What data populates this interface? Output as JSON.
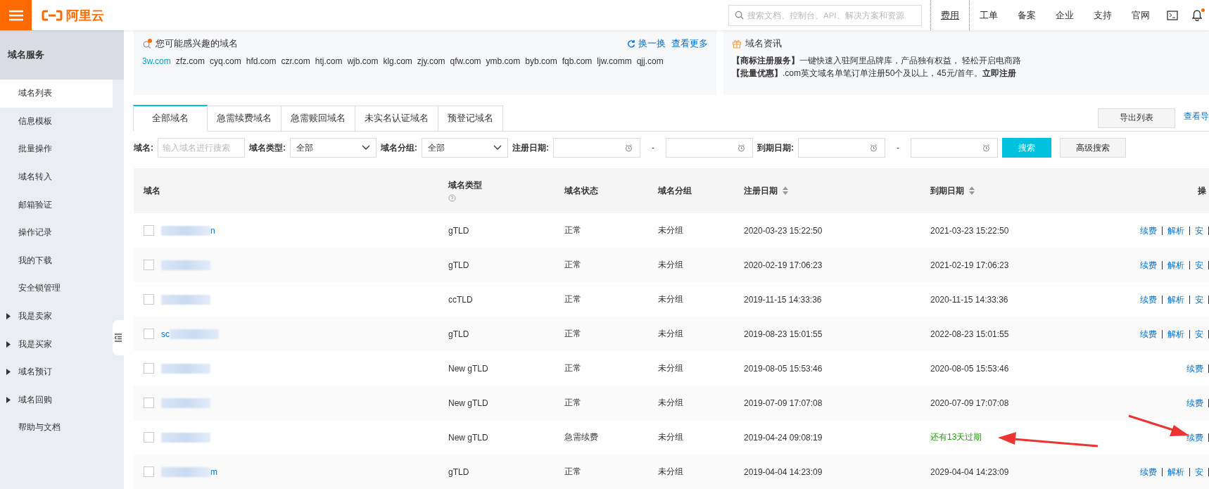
{
  "topbar": {
    "logo_text": "阿里云",
    "search": {
      "placeholder": "搜索文档、控制台、API、解决方案和资源"
    },
    "nav": [
      {
        "label": "费用",
        "selected": true
      },
      {
        "label": "工单",
        "selected": false
      },
      {
        "label": "备案",
        "selected": false
      },
      {
        "label": "企业",
        "selected": false
      },
      {
        "label": "支持",
        "selected": false
      },
      {
        "label": "官网",
        "selected": false
      }
    ],
    "notification_dot": true
  },
  "sidebar": {
    "title": "域名服务",
    "items": [
      {
        "label": "域名列表",
        "kind": "item",
        "selected": true
      },
      {
        "label": "信息模板",
        "kind": "item",
        "selected": false
      },
      {
        "label": "批量操作",
        "kind": "item",
        "selected": false
      },
      {
        "label": "域名转入",
        "kind": "item",
        "selected": false
      },
      {
        "label": "邮箱验证",
        "kind": "item",
        "selected": false
      },
      {
        "label": "操作记录",
        "kind": "item",
        "selected": false
      },
      {
        "label": "我的下载",
        "kind": "item",
        "selected": false
      },
      {
        "label": "安全锁管理",
        "kind": "item",
        "selected": false
      },
      {
        "label": "我是卖家",
        "kind": "group",
        "selected": false
      },
      {
        "label": "我是买家",
        "kind": "group",
        "selected": false
      },
      {
        "label": "域名预订",
        "kind": "group",
        "selected": false
      },
      {
        "label": "域名回购",
        "kind": "group",
        "selected": false
      },
      {
        "label": "帮助与文档",
        "kind": "item",
        "selected": false
      }
    ]
  },
  "suggestions": {
    "title": "您可能感兴趣的域名",
    "refresh": "换一换",
    "more": "查看更多",
    "domains": [
      {
        "name": "3w.com",
        "selected": true
      },
      {
        "name": "zfz.com",
        "selected": false
      },
      {
        "name": "cyq.com",
        "selected": false
      },
      {
        "name": "hfd.com",
        "selected": false
      },
      {
        "name": "czr.com",
        "selected": false
      },
      {
        "name": "htj.com",
        "selected": false
      },
      {
        "name": "wjb.com",
        "selected": false
      },
      {
        "name": "klg.com",
        "selected": false
      },
      {
        "name": "zjy.com",
        "selected": false
      },
      {
        "name": "qfw.com",
        "selected": false
      },
      {
        "name": "ymb.com",
        "selected": false
      },
      {
        "name": "byb.com",
        "selected": false
      },
      {
        "name": "fqb.com",
        "selected": false
      },
      {
        "name": "ljw.comm",
        "selected": false
      },
      {
        "name": "qjj.com",
        "selected": false
      }
    ]
  },
  "news": {
    "title": "域名资讯",
    "lines": [
      "**【商标注册服务】**一键快速入驻阿里品牌库，产品独有权益， 轻松开启电商路",
      "**【批量优惠】**.com英文域名单笔订单注册50个及以上，45元/首年。**立即注册**"
    ]
  },
  "tabs": [
    {
      "label": "全部域名",
      "selected": true
    },
    {
      "label": "急需续费域名",
      "selected": false
    },
    {
      "label": "急需赎回域名",
      "selected": false
    },
    {
      "label": "未实名认证域名",
      "selected": false
    },
    {
      "label": "预登记域名",
      "selected": false
    }
  ],
  "export_button": "导出列表",
  "view_exports": "查看导",
  "filters": {
    "domain_label": "域名:",
    "domain_placeholder": "输入域名进行搜索",
    "type_label": "域名类型:",
    "type_value": "全部",
    "group_label": "域名分组:",
    "group_value": "全部",
    "reg_label": "注册日期:",
    "range_sep": "-",
    "exp_label": "到期日期:",
    "search_button": "搜索",
    "advanced_button": "高级搜索"
  },
  "table": {
    "columns": [
      "域名",
      "域名类型",
      "域名状态",
      "域名分组",
      "注册日期",
      "到期日期",
      "操"
    ],
    "rows": [
      {
        "domain_suffix": "n",
        "checked": false,
        "type": "gTLD",
        "status": "正常",
        "group": "未分组",
        "registered": "2020-03-23 15:22:50",
        "expires": "2021-03-23 15:22:50",
        "warning": false,
        "actions": [
          "续费",
          "解析",
          "安"
        ]
      },
      {
        "checked": false,
        "type": "gTLD",
        "status": "正常",
        "group": "未分组",
        "registered": "2020-02-19 17:06:23",
        "expires": "2021-02-19 17:06:23",
        "warning": false,
        "actions": [
          "续费",
          "解析",
          "安"
        ]
      },
      {
        "checked": false,
        "type": "ccTLD",
        "status": "正常",
        "group": "未分组",
        "registered": "2019-11-15 14:33:36",
        "expires": "2020-11-15 14:33:36",
        "warning": false,
        "actions": [
          "续费",
          "解析",
          "安"
        ]
      },
      {
        "domain_prefix": "sc",
        "checked": false,
        "type": "gTLD",
        "status": "正常",
        "group": "未分组",
        "registered": "2019-08-23 15:01:55",
        "expires": "2022-08-23 15:01:55",
        "warning": false,
        "actions": [
          "续费",
          "解析",
          "安"
        ]
      },
      {
        "checked": false,
        "type": "New gTLD",
        "status": "正常",
        "group": "未分组",
        "registered": "2019-08-05 15:53:46",
        "expires": "2020-08-05 15:53:46",
        "warning": false,
        "actions": [
          "续费"
        ]
      },
      {
        "checked": false,
        "type": "New gTLD",
        "status": "正常",
        "group": "未分组",
        "registered": "2019-07-09 17:07:08",
        "expires": "2020-07-09 17:07:08",
        "warning": false,
        "actions": [
          "续费"
        ]
      },
      {
        "checked": false,
        "type": "New gTLD",
        "status": "急需续费",
        "group": "未分组",
        "registered": "2019-04-24 09:08:19",
        "expires": "还有13天过期",
        "warning": true,
        "actions": [
          "续费"
        ]
      },
      {
        "domain_suffix": "m",
        "checked": false,
        "type": "gTLD",
        "status": "正常",
        "group": "未分组",
        "registered": "2019-04-04 14:23:09",
        "expires": "2029-04-04 14:23:09",
        "warning": false,
        "actions": [
          "续费",
          "解析",
          "安"
        ]
      }
    ]
  }
}
